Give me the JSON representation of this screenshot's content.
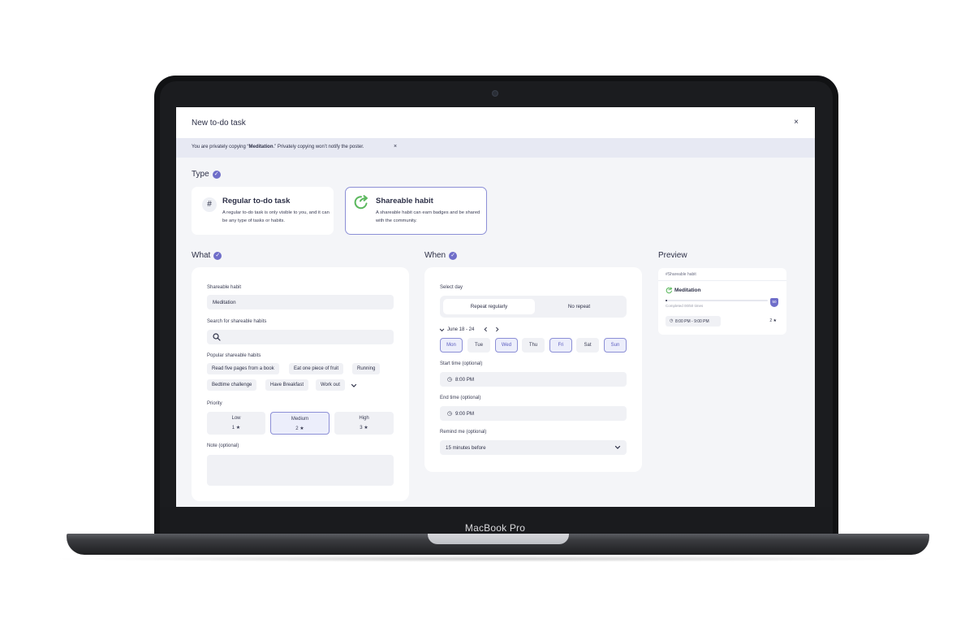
{
  "device_brand": "MacBook Pro",
  "dialog": {
    "title": "New to-do task",
    "close_glyph": "×"
  },
  "notice": {
    "prefix": "You are privately copying “",
    "name": "Meditation",
    "suffix": ".” Privately copying won’t notify the poster.",
    "close_glyph": "×"
  },
  "type": {
    "label": "Type",
    "options": [
      {
        "title": "Regular to-do task",
        "description": "A regular to-do task is only visible to you, and it can be any type of tasks or habits.",
        "icon": "hash-icon",
        "glyph": "#"
      },
      {
        "title": "Shareable habit",
        "description": "A shareable habit can earn badges and be shared with the community.",
        "icon": "share-arrow-icon",
        "selected": true
      }
    ]
  },
  "what": {
    "label": "What",
    "habit_label": "Shareable habit",
    "habit_value": "Meditation",
    "search_label": "Search for shareable habits",
    "search_placeholder": "",
    "popular_label": "Popular shareable habits",
    "popular": [
      "Read five pages from a book",
      "Eat one piece of fruit",
      "Running",
      "Bedtime challenge",
      "Have Breakfast",
      "Work out"
    ],
    "priority_label": "Priority",
    "priorities": [
      {
        "label": "Low",
        "value": "1 ★"
      },
      {
        "label": "Medium",
        "value": "2 ★",
        "selected": true
      },
      {
        "label": "High",
        "value": "3 ★"
      }
    ],
    "note_label": "Note (optional)",
    "note_value": ""
  },
  "when": {
    "label": "When",
    "select_day_label": "Select day",
    "repeat_options": [
      "Repeat regularly",
      "No repeat"
    ],
    "repeat_selected": "Repeat regularly",
    "week_range": "June 18 - 24",
    "days": [
      {
        "label": "Mon",
        "selected": true
      },
      {
        "label": "Tue",
        "selected": false
      },
      {
        "label": "Wed",
        "selected": true
      },
      {
        "label": "Thu",
        "selected": false
      },
      {
        "label": "Fri",
        "selected": true
      },
      {
        "label": "Sat",
        "selected": false
      },
      {
        "label": "Sun",
        "selected": true
      }
    ],
    "start_label": "Start time (optional)",
    "start_value": "8:00 PM",
    "end_label": "End time (optional)",
    "end_value": "9:00 PM",
    "remind_label": "Remind me (optional)",
    "remind_value": "15 minutes before"
  },
  "preview": {
    "label": "Preview",
    "tag": "#Shareable habit",
    "habit_name": "Meditation",
    "progress_text": "Completed 00/50 times",
    "progress_fraction": 0.0,
    "badge_value": "50",
    "time_range": "8:00 PM - 9:00 PM",
    "stars": "2 ★"
  },
  "colors": {
    "accent": "#6f6ec9",
    "selected_border": "#8c8fd6",
    "notice_bg": "#e7e9f3",
    "screen_bg": "#f4f5f8",
    "success_green": "#5bb85d"
  }
}
